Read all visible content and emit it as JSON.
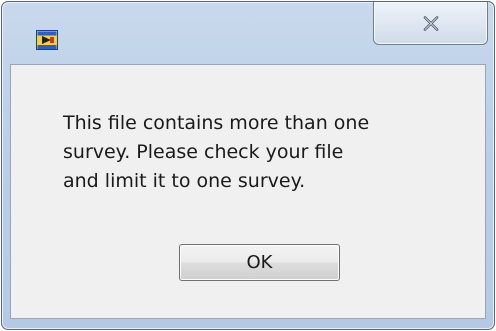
{
  "dialog": {
    "title": "",
    "message": "This file contains more than one\nsurvey.  Please check your file\nand limit it to one survey.",
    "ok_label": "OK"
  },
  "icons": {
    "app": "labview-app-icon",
    "close": "close-icon"
  },
  "colors": {
    "frame": "#bcd0e8",
    "client": "#f0f0f0",
    "close_glyph": "#4a5668",
    "button_border": "#707070"
  }
}
